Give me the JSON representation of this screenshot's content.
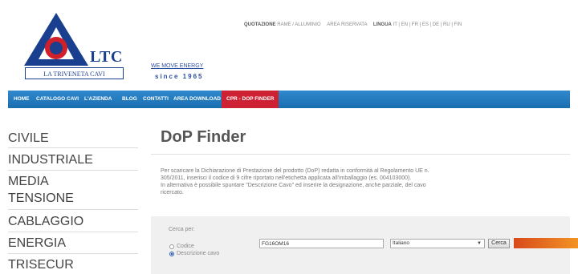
{
  "header": {
    "brand_ltc": "LTC",
    "brand_name": "LA TRIVENETA CAVI",
    "tagline": "WE MOVE ENERGY",
    "since": "since 1965",
    "top_links": {
      "quotazione": "QUOTAZIONE",
      "rame": "RAME / ALLUMINIO",
      "area_riservata": "AREA RISERVATA",
      "lingua": "LINGUA",
      "languages": [
        "IT",
        "EN",
        "FR",
        "ES",
        "DE",
        "RU",
        "FIN"
      ]
    }
  },
  "nav": {
    "items": [
      "HOME",
      "CATALOGO CAVI",
      "L'AZIENDA",
      "BLOG",
      "CONTATTI",
      "AREA DOWNLOAD",
      "CPR - DOP FINDER"
    ],
    "active_index": 6
  },
  "sidebar": {
    "items": [
      "CIVILE",
      "INDUSTRIALE",
      "MEDIA",
      "TENSIONE",
      "CABLAGGIO",
      "ENERGIA",
      "TRISECUR"
    ]
  },
  "main": {
    "title": "DoP Finder",
    "intro_lines": [
      "Per scaricare la Dichiarazione di Prestazione del prodotto (DoP) redatta in conformità al Regolamento UE n.",
      "305/2011, inserisci il codice di 9 cifre riportato nell'etichetta applicata all'imballaggio (es. 004103000).",
      "In alternativa è possibile spuntare \"Descrizione Cavo\" ed inserire la designazione, anche parziale, del cavo",
      "ricercato."
    ],
    "search": {
      "label": "Cerca per:",
      "option_codice": "Codice",
      "option_descrizione": "Descrizione cavo",
      "selected_option": "Descrizione cavo",
      "input_value": "FG16OM16",
      "language_select": "Italiano",
      "button": "Cerca"
    }
  },
  "colors": {
    "nav_blue": "#1f78bd",
    "nav_active": "#cc2233",
    "brand_blue": "#1a3f8f",
    "logo_red": "#d0202a",
    "accent_orange": "#f08a24"
  }
}
